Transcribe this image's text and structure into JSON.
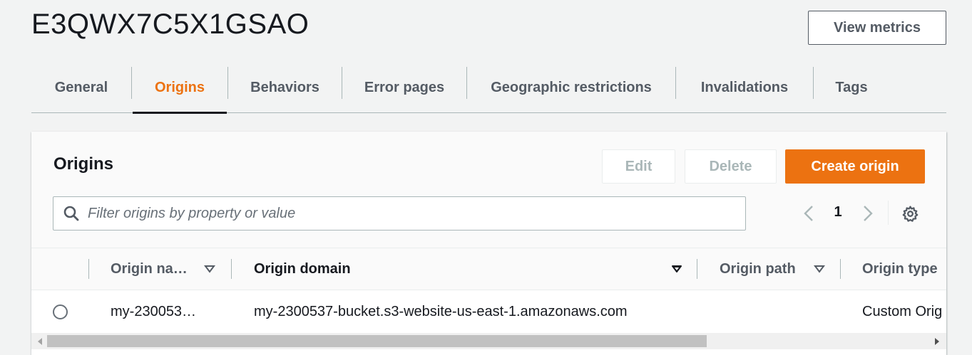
{
  "distribution": {
    "id": "E3QWX7C5X1GSAO",
    "view_metrics_label": "View metrics"
  },
  "tabs": [
    {
      "label": "General",
      "active": false
    },
    {
      "label": "Origins",
      "active": true
    },
    {
      "label": "Behaviors",
      "active": false
    },
    {
      "label": "Error pages",
      "active": false
    },
    {
      "label": "Geographic restrictions",
      "active": false
    },
    {
      "label": "Invalidations",
      "active": false
    },
    {
      "label": "Tags",
      "active": false
    }
  ],
  "origins_panel": {
    "title": "Origins",
    "edit_label": "Edit",
    "delete_label": "Delete",
    "create_label": "Create origin",
    "search": {
      "placeholder": "Filter origins by property or value",
      "value": ""
    },
    "pagination": {
      "current_page": "1"
    },
    "columns": [
      {
        "label": "Origin na…"
      },
      {
        "label": "Origin domain"
      },
      {
        "label": "Origin path"
      },
      {
        "label": "Origin type"
      }
    ],
    "rows": [
      {
        "selected": false,
        "origin_name": "my-230053…",
        "origin_domain": "my-2300537-bucket.s3-website-us-east-1.amazonaws.com",
        "origin_path": "",
        "origin_type": "Custom Orig"
      }
    ]
  },
  "icons": {
    "search": "search-icon",
    "prev_page": "chevron-left-icon",
    "next_page": "chevron-right-icon",
    "settings": "gear-icon",
    "sort": "sort-caret-down-icon",
    "radio": "radio-button-icon",
    "scroll_left": "scroll-left-arrow-icon",
    "scroll_right": "scroll-right-arrow-icon"
  },
  "colors": {
    "accent_orange": "#ec7211",
    "tab_text": "#545b64",
    "heading_text": "#16191f",
    "border": "#aab7b8",
    "page_bg": "#f2f3f3"
  }
}
